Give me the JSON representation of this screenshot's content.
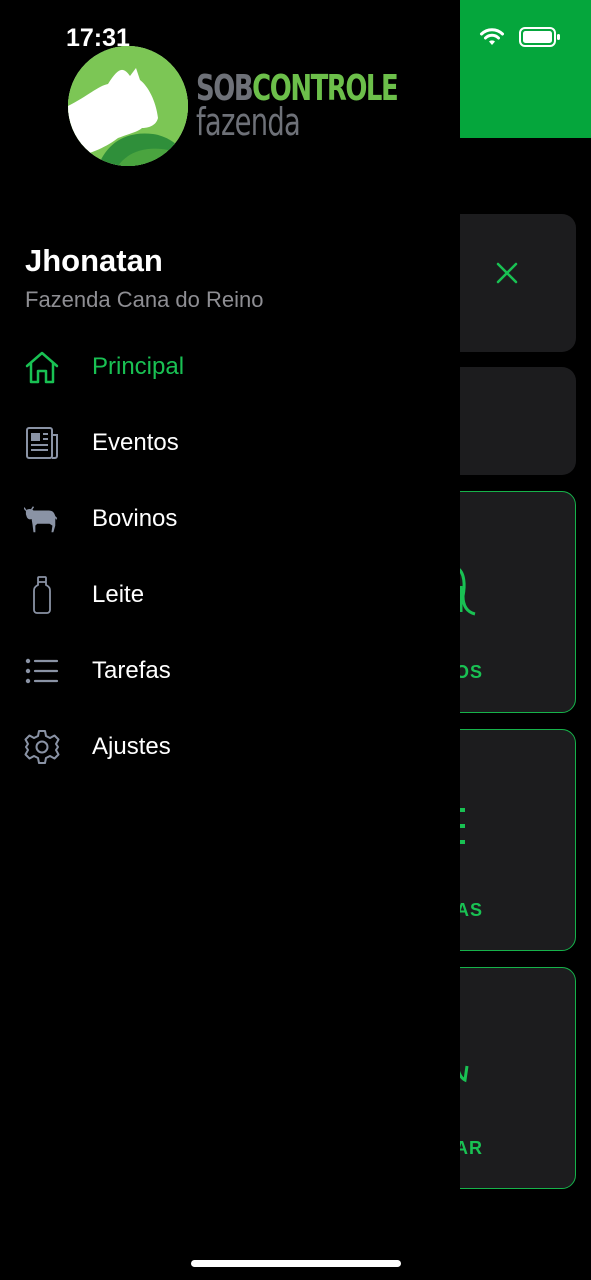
{
  "status": {
    "time": "17:31"
  },
  "logo": {
    "line1_part1": "SOB",
    "line1_part2": "CONTROLE",
    "line2": "fazenda"
  },
  "user": {
    "name": "Jhonatan",
    "farm": "Fazenda Cana do Reino"
  },
  "menu": [
    {
      "label": "Principal",
      "icon": "home-icon",
      "active": true
    },
    {
      "label": "Eventos",
      "icon": "newspaper-icon",
      "active": false
    },
    {
      "label": "Bovinos",
      "icon": "cow-icon",
      "active": false
    },
    {
      "label": "Leite",
      "icon": "milk-bottle-icon",
      "active": false
    },
    {
      "label": "Tarefas",
      "icon": "list-icon",
      "active": false
    },
    {
      "label": "Ajustes",
      "icon": "gear-icon",
      "active": false
    }
  ],
  "background": {
    "cards": [
      "OS",
      "AS",
      "ZAR"
    ]
  },
  "colors": {
    "accent": "#19c153",
    "header": "#05a63c",
    "card": "#1c1c1e",
    "muted": "#8e8e93"
  }
}
